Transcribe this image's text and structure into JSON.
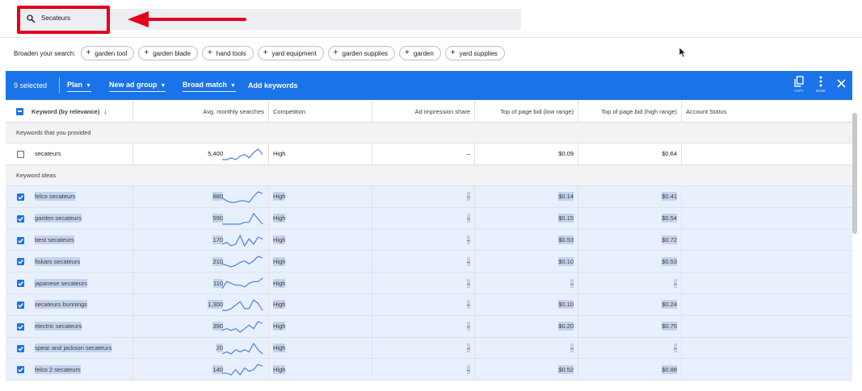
{
  "search": {
    "value": "Secateurs"
  },
  "broaden": {
    "label": "Broaden your search:",
    "chips": [
      "garden tool",
      "garden blade",
      "hand tools",
      "yard equipment",
      "garden supplies",
      "garden",
      "yard supplies"
    ]
  },
  "toolbar": {
    "selected": "9 selected",
    "plan": "Plan",
    "ad_group": "New ad group",
    "match": "Broad match",
    "add_keywords": "Add keywords",
    "copy_label": "COPY",
    "more_label": "MORE"
  },
  "columns": {
    "keyword": "Keyword (by relevance)",
    "avg_searches": "Avg. monthly searches",
    "competition": "Competition",
    "ad_share": "Ad impression share",
    "bid_low": "Top of page bid (low range)",
    "bid_high": "Top of page bid (high range)",
    "status": "Account Status"
  },
  "groups": {
    "provided": "Keywords that you provided",
    "ideas": "Keyword ideas"
  },
  "provided_rows": [
    {
      "keyword": "secateurs",
      "searches": "5,400",
      "competition": "High",
      "share": "–",
      "low": "$0.09",
      "high": "$0.64",
      "selected": false,
      "trend": [
        3,
        3,
        4,
        3,
        5,
        6,
        4,
        7,
        9,
        6
      ]
    }
  ],
  "idea_rows": [
    {
      "keyword": "felco secateurs",
      "searches": "880",
      "competition": "High",
      "share": "–",
      "low": "$0.14",
      "high": "$0.41",
      "selected": true,
      "trend": [
        5,
        3,
        2,
        2,
        3,
        3,
        2,
        6,
        9,
        8
      ]
    },
    {
      "keyword": "garden secateurs",
      "searches": "590",
      "competition": "High",
      "share": "–",
      "low": "$0.15",
      "high": "$0.54",
      "selected": true,
      "trend": [
        2,
        2,
        2,
        2,
        2,
        3,
        3,
        8,
        5,
        2
      ]
    },
    {
      "keyword": "best secateurs",
      "searches": "170",
      "competition": "High",
      "share": "–",
      "low": "$0.53",
      "high": "$0.72",
      "selected": true,
      "trend": [
        3,
        4,
        2,
        3,
        8,
        2,
        6,
        3,
        7,
        6
      ]
    },
    {
      "keyword": "fiskars secateurs",
      "searches": "210",
      "competition": "High",
      "share": "–",
      "low": "$0.10",
      "high": "$0.53",
      "selected": true,
      "trend": [
        4,
        3,
        2,
        3,
        5,
        6,
        4,
        6,
        9,
        8
      ]
    },
    {
      "keyword": "japanese secateurs",
      "searches": "110",
      "competition": "High",
      "share": "–",
      "low": "–",
      "high": "–",
      "selected": true,
      "trend": [
        2,
        6,
        5,
        4,
        4,
        3,
        5,
        6,
        6,
        8
      ]
    },
    {
      "keyword": "secateurs bunnings",
      "searches": "1,300",
      "competition": "High",
      "share": "–",
      "low": "$0.10",
      "high": "$0.24",
      "selected": true,
      "trend": [
        2,
        2,
        3,
        5,
        7,
        3,
        3,
        8,
        6,
        2
      ]
    },
    {
      "keyword": "electric secateurs",
      "searches": "390",
      "competition": "High",
      "share": "–",
      "low": "$0.20",
      "high": "$0.75",
      "selected": true,
      "trend": [
        3,
        4,
        3,
        4,
        2,
        4,
        6,
        4,
        8,
        7
      ]
    },
    {
      "keyword": "spear and jackson secateurs",
      "searches": "20",
      "competition": "High",
      "share": "–",
      "low": "–",
      "high": "–",
      "selected": true,
      "trend": [
        3,
        4,
        3,
        5,
        4,
        5,
        4,
        8,
        5,
        3
      ]
    },
    {
      "keyword": "felco 2 secateurs",
      "searches": "140",
      "competition": "High",
      "share": "–",
      "low": "$0.52",
      "high": "$0.88",
      "selected": true,
      "trend": [
        3,
        3,
        2,
        5,
        2,
        6,
        4,
        5,
        8,
        7
      ]
    }
  ],
  "colors": {
    "accent": "#1a73e8",
    "annotation": "#e3001b",
    "selected_row": "#e8f0fe",
    "text_highlight": "#c4d2ec"
  }
}
